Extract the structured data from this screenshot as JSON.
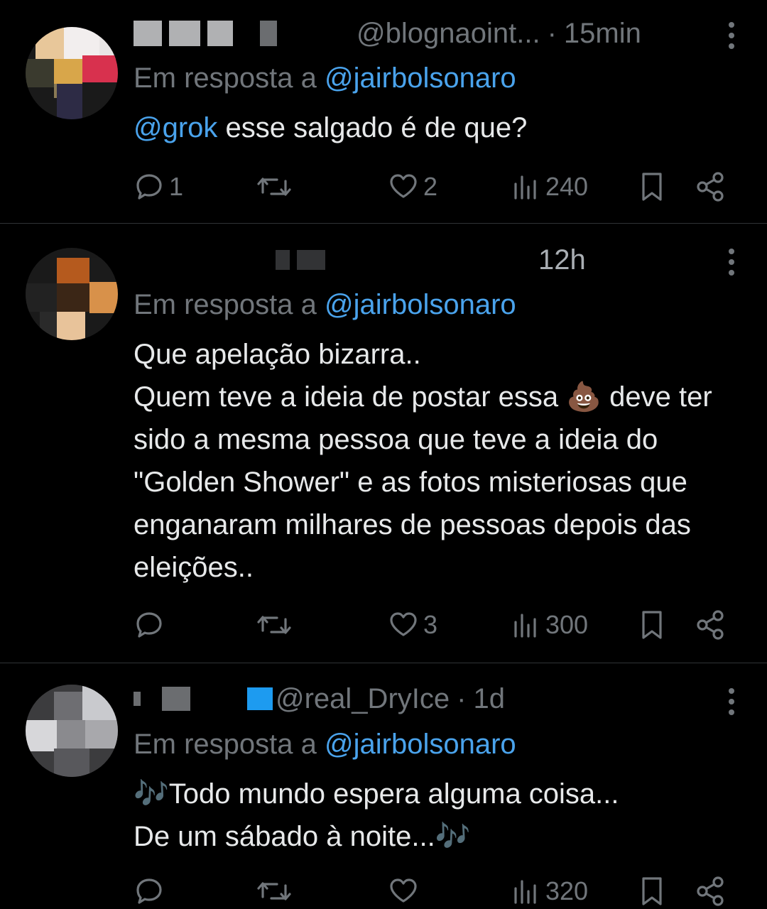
{
  "tweets": [
    {
      "handle": "@blognaoint...",
      "separator": "·",
      "time": "15min",
      "reply_prefix": "Em resposta a",
      "reply_to": "@jairbolsonaro",
      "text_mention": "@grok",
      "text": " esse salgado é de que?",
      "replies": "1",
      "retweets": "",
      "likes": "2",
      "views": "240"
    },
    {
      "handle": "",
      "time": "12h",
      "reply_prefix": "Em resposta a",
      "reply_to": "@jairbolsonaro",
      "text_lines": [
        "Que apelação bizarra..",
        "Quem teve a ideia de postar essa 💩 deve ter sido a mesma pessoa que teve a ideia do \"Golden Shower\" e as fotos misteriosas que enganaram milhares de pessoas depois das eleições.."
      ],
      "replies": "",
      "retweets": "",
      "likes": "3",
      "views": "300"
    },
    {
      "handle": "@real_DryIce",
      "separator": "·",
      "time": "1d",
      "reply_prefix": "Em resposta a",
      "reply_to": "@jairbolsonaro",
      "text_lines": [
        "🎶Todo mundo espera alguma coisa...",
        "De um sábado à noite...🎶"
      ],
      "replies": "",
      "retweets": "",
      "likes": "",
      "views": "320"
    }
  ],
  "icons": {
    "reply": "reply-icon",
    "retweet": "retweet-icon",
    "like": "heart-icon",
    "views": "views-icon",
    "bookmark": "bookmark-icon",
    "share": "share-icon",
    "more": "more-icon"
  },
  "colors": {
    "background": "#000000",
    "text": "#e7e9ea",
    "secondary": "#71767b",
    "mention": "#4aa3ec"
  }
}
